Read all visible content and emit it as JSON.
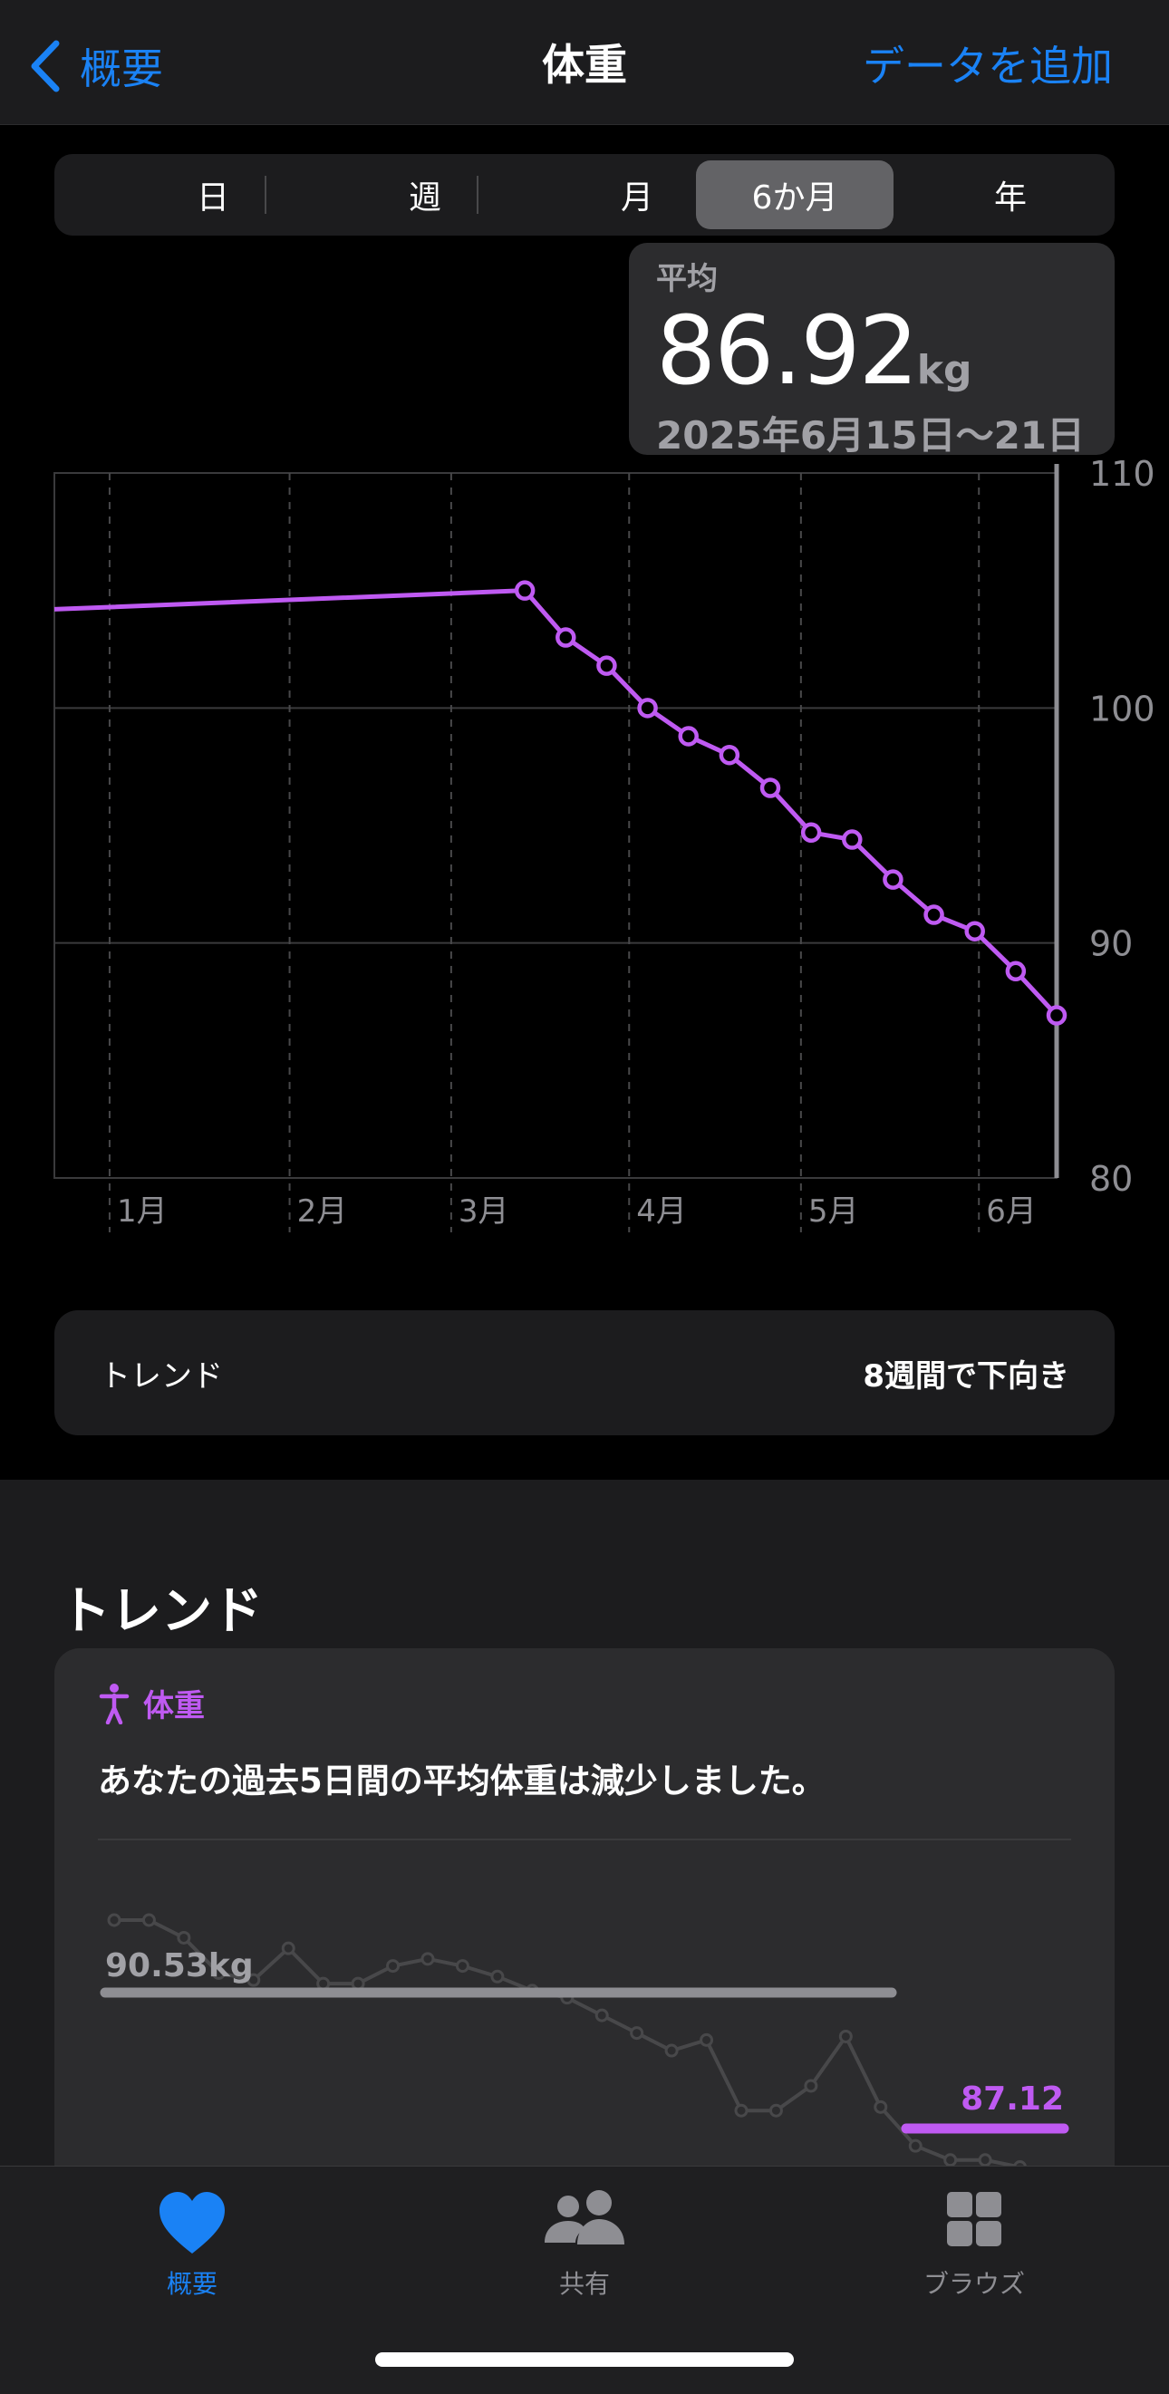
{
  "nav": {
    "back_label": "概要",
    "title": "体重",
    "add_label": "データを追加"
  },
  "segments": [
    {
      "label": "日",
      "active": false
    },
    {
      "label": "週",
      "active": false
    },
    {
      "label": "月",
      "active": false
    },
    {
      "label": "6か月",
      "active": true
    },
    {
      "label": "年",
      "active": false
    }
  ],
  "tooltip": {
    "label": "平均",
    "value": "86.92",
    "unit": "kg",
    "date": "2025年6月15日～21日"
  },
  "chart_data": {
    "type": "line",
    "series_color": "#bf5af2",
    "x_labels": [
      "1月",
      "2月",
      "3月",
      "4月",
      "5月",
      "6月"
    ],
    "y_ticks": [
      "110",
      "100",
      "90",
      "80"
    ],
    "ylim": [
      80,
      110
    ],
    "points": [
      {
        "week": 0,
        "y": 104.2,
        "marker": false
      },
      {
        "week": 23,
        "y": 105.0,
        "marker": true
      },
      {
        "week": 25,
        "y": 103.0,
        "marker": true
      },
      {
        "week": 27,
        "y": 101.8,
        "marker": true
      },
      {
        "week": 29,
        "y": 100.0,
        "marker": true
      },
      {
        "week": 31,
        "y": 98.8,
        "marker": true
      },
      {
        "week": 33,
        "y": 98.0,
        "marker": true
      },
      {
        "week": 35,
        "y": 96.6,
        "marker": true
      },
      {
        "week": 37,
        "y": 94.7,
        "marker": true
      },
      {
        "week": 39,
        "y": 94.4,
        "marker": true
      },
      {
        "week": 41,
        "y": 92.7,
        "marker": true
      },
      {
        "week": 43,
        "y": 91.2,
        "marker": true
      },
      {
        "week": 45,
        "y": 90.5,
        "marker": true
      },
      {
        "week": 47,
        "y": 88.8,
        "marker": true
      },
      {
        "week": 49,
        "y": 86.92,
        "marker": true
      }
    ],
    "grid": true
  },
  "trend_row": {
    "label": "トレンド",
    "value": "8週間で下向き"
  },
  "trends_section": {
    "title": "トレンド",
    "card": {
      "category": "体重",
      "message": "あなたの過去5日間の平均体重は減少しました。",
      "previous_average": "90.53kg",
      "current_average": "87.12",
      "mini_series": [
        95.0,
        95.0,
        94.5,
        93.5,
        93.3,
        94.2,
        93.2,
        93.2,
        93.7,
        93.9,
        93.7,
        93.4,
        93.0,
        92.8,
        92.3,
        91.8,
        91.3,
        91.6,
        89.6,
        89.6,
        90.3,
        91.7,
        89.7,
        88.6,
        88.2,
        88.2,
        88.0,
        87.5
      ],
      "previous_color": "#8e8e93",
      "current_color": "#bf5af2"
    }
  },
  "tabbar": {
    "items": [
      {
        "label": "概要",
        "icon": "heart-icon",
        "active": true
      },
      {
        "label": "共有",
        "icon": "people-icon",
        "active": false
      },
      {
        "label": "ブラウズ",
        "icon": "grid-icon",
        "active": false
      }
    ]
  }
}
